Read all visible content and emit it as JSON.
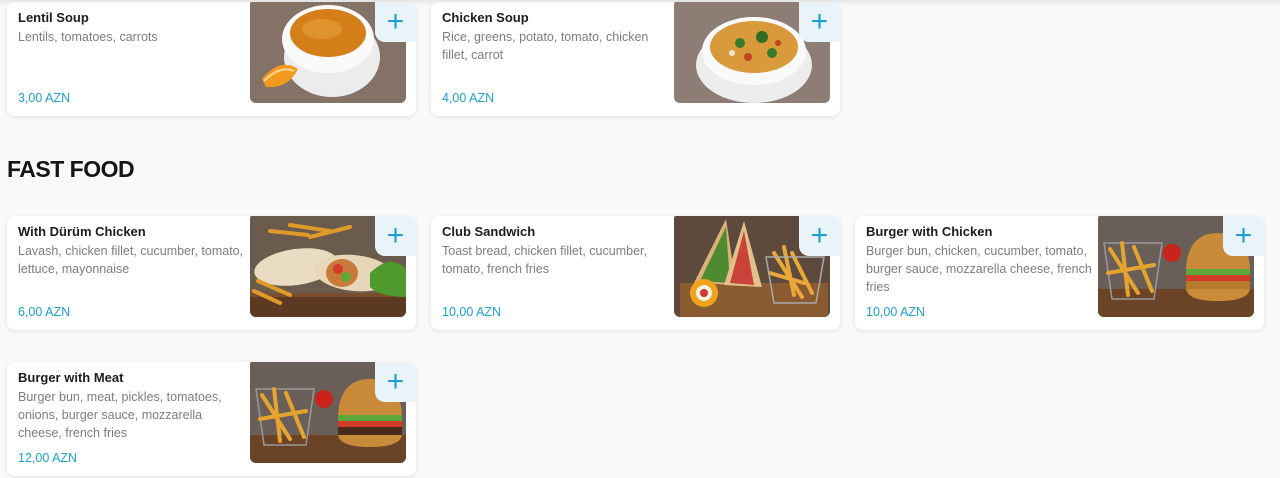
{
  "soups": [
    {
      "title": "Lentil Soup",
      "desc": "Lentils, tomatoes, carrots",
      "price": "3,00 AZN",
      "add": "+"
    },
    {
      "title": "Chicken Soup",
      "desc": "Rice, greens, potato, tomato, chicken fillet, carrot",
      "price": "4,00 AZN",
      "add": "+"
    }
  ],
  "fast_food": {
    "heading": "FAST FOOD",
    "items": [
      {
        "title": "With Dürüm Chicken",
        "desc": "Lavash, chicken fillet, cucumber, tomato, lettuce, mayonnaise",
        "price": "6,00 AZN",
        "add": "+"
      },
      {
        "title": "Club Sandwich",
        "desc": "Toast bread, chicken fillet, cucumber, tomato, french fries",
        "price": "10,00 AZN",
        "add": "+"
      },
      {
        "title": "Burger with Chicken",
        "desc": "Burger bun, chicken, cucumber, tomato, burger sauce, mozzarella cheese, french fries",
        "price": "10,00 AZN",
        "add": "+"
      },
      {
        "title": "Burger with Meat",
        "desc": "Burger bun, meat, pickles, tomatoes, onions, burger sauce, mozzarella cheese, french fries",
        "price": "12,00 AZN",
        "add": "+"
      }
    ]
  },
  "colors": {
    "accent": "#1d9fd2",
    "add_bg": "#e9f4fa",
    "page_bg": "#f9f9f9"
  },
  "icons": {
    "add": "plus-icon"
  }
}
